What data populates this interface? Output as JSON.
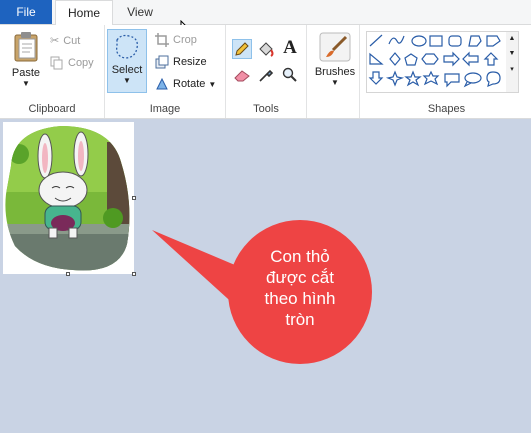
{
  "tabs": {
    "file": "File",
    "home": "Home",
    "view": "View"
  },
  "clipboard": {
    "paste": "Paste",
    "cut": "Cut",
    "copy": "Copy",
    "label": "Clipboard"
  },
  "image": {
    "select": "Select",
    "crop": "Crop",
    "resize": "Resize",
    "rotate": "Rotate",
    "label": "Image"
  },
  "tools": {
    "label": "Tools"
  },
  "brushes": {
    "label": "Brushes"
  },
  "shapes": {
    "label": "Shapes"
  },
  "callout": {
    "line1": "Con thỏ",
    "line2": "được cắt",
    "line3": "theo hình",
    "line4": "tròn"
  },
  "colors": {
    "file_tab": "#1e63bf",
    "canvas_bg": "#c9d3e4",
    "callout": "#ee4444",
    "selection": "#cde4f7"
  }
}
